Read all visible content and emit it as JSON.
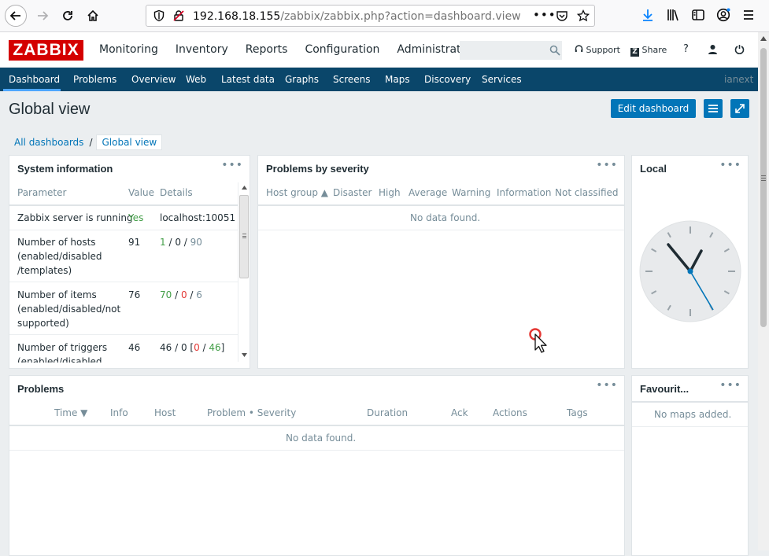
{
  "browser": {
    "url_host": "192.168.18.155",
    "url_path": "/zabbix/zabbix.php?action=dashboard.view"
  },
  "header": {
    "logo": "ZABBIX",
    "menu": [
      "Monitoring",
      "Inventory",
      "Reports",
      "Configuration",
      "Administration"
    ],
    "support_label": "Support",
    "share_label": "Share",
    "help_label": "?"
  },
  "subnav": {
    "items": [
      "Dashboard",
      "Problems",
      "Overview",
      "Web",
      "Latest data",
      "Graphs",
      "Screens",
      "Maps",
      "Discovery",
      "Services"
    ],
    "user": "ianext"
  },
  "page": {
    "title": "Global view",
    "edit_button": "Edit dashboard",
    "breadcrumb_root": "All dashboards",
    "breadcrumb_sep": "/",
    "breadcrumb_current": "Global view"
  },
  "widgets": {
    "menu_glyph": "•••",
    "system_info": {
      "title": "System information",
      "columns": [
        "Parameter",
        "Value",
        "Details"
      ],
      "rows": [
        {
          "param": "Zabbix server is running",
          "value": "Yes",
          "details": "localhost:10051"
        },
        {
          "param": "Number of hosts (enabled/disabled /templates)",
          "value": "91",
          "d1": "1",
          "d2": "0",
          "d3": "90"
        },
        {
          "param": "Number of items (enabled/disabled/not supported)",
          "value": "76",
          "d1": "70",
          "d2": "0",
          "d3": "6"
        },
        {
          "param": "Number of triggers (enabled/disabled",
          "value": "46",
          "d1": "46 / 0 [",
          "d2": "0",
          "d3": "46",
          "d4": "]"
        }
      ]
    },
    "problems_by_severity": {
      "title": "Problems by severity",
      "columns": [
        "Host group ▲",
        "Disaster",
        "High",
        "Average",
        "Warning",
        "Information",
        "Not classified"
      ],
      "empty": "No data found."
    },
    "clock": {
      "title": "Local"
    },
    "problems": {
      "title": "Problems",
      "columns": [
        "Time ▼",
        "Info",
        "Host",
        "Problem • Severity",
        "Duration",
        "Ack",
        "Actions",
        "Tags"
      ],
      "empty": "No data found."
    },
    "favourite_maps": {
      "title": "Favourit...",
      "empty": "No maps added."
    }
  }
}
